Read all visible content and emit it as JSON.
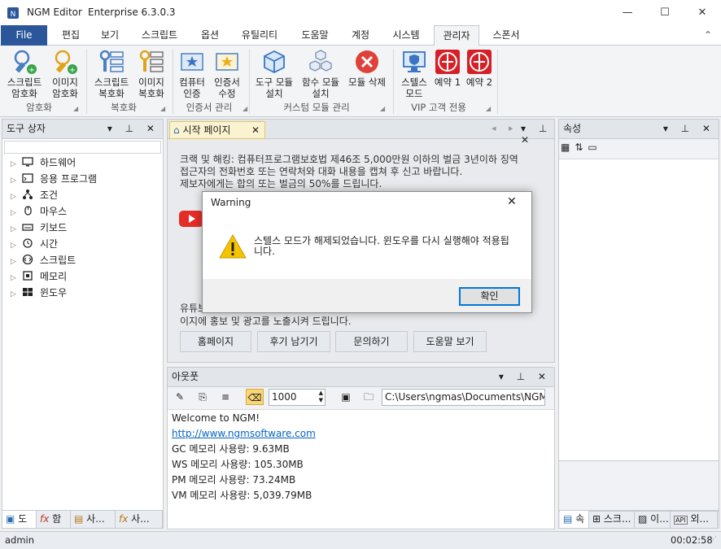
{
  "window": {
    "app_title": "NGM Editor",
    "edition": "Enterprise 6.3.0.3",
    "minimize": "—",
    "maximize": "☐",
    "close": "✕"
  },
  "menu": {
    "file": "File",
    "tabs": [
      "편집",
      "보기",
      "스크립트",
      "옵션",
      "유틸리티",
      "도움말",
      "계정",
      "시스템",
      "관리자",
      "스폰서"
    ],
    "active": "관리자",
    "collapse": "⌃"
  },
  "ribbon": {
    "groups": [
      {
        "label": "암호화",
        "buttons": [
          {
            "line1": "스크립트",
            "line2": "암호화"
          },
          {
            "line1": "이미지",
            "line2": "암호화"
          }
        ]
      },
      {
        "label": "복호화",
        "buttons": [
          {
            "line1": "스크립트",
            "line2": "복호화"
          },
          {
            "line1": "이미지",
            "line2": "복호화"
          }
        ]
      },
      {
        "label": "인증서 관리",
        "buttons": [
          {
            "line1": "컴퓨터",
            "line2": "인증"
          },
          {
            "line1": "인증서",
            "line2": "수정"
          }
        ]
      },
      {
        "label": "커스텀 모듈 관리",
        "buttons": [
          {
            "line1": "도구 모듈",
            "line2": "설치"
          },
          {
            "line1": "함수 모듈",
            "line2": "설치"
          },
          {
            "line1": "모듈 삭제",
            "line2": ""
          }
        ]
      },
      {
        "label": "VIP 고객 전용",
        "buttons": [
          {
            "line1": "스텔스",
            "line2": "모드"
          },
          {
            "line1": "예약 1",
            "line2": ""
          },
          {
            "line1": "예약 2",
            "line2": ""
          }
        ]
      }
    ]
  },
  "toolbox": {
    "title": "도구 상자",
    "items": [
      "하드웨어",
      "응용 프로그램",
      "조건",
      "마우스",
      "키보드",
      "시간",
      "스크립트",
      "메모리",
      "윈도우"
    ],
    "bottom_tabs": [
      "도",
      "함",
      "사...",
      "사..."
    ]
  },
  "document": {
    "tab": "시작 페이지",
    "notice_lines": [
      "크랙 및 해킹: 컴퓨터프로그램보호법 제46조 5,000만원 이하의 벌금 3년이하 징역",
      "접근자의 전화번호 또는 연락처와 대화 내용을 캡쳐 후 신고 바랍니다.",
      "제보자에게는 합의 또는 벌금의 50%를 드립니다."
    ],
    "promo_partial": "유튜브",
    "promo_line2": "이지에 홍보 및 광고를 노출시켜 드립니다.",
    "buttons": [
      "홈페이지",
      "후기 남기기",
      "문의하기",
      "도움말 보기"
    ]
  },
  "output": {
    "title": "아웃풋",
    "count": "1000",
    "path": "C:\\Users\\ngmas\\Documents\\NGM6\\",
    "lines": [
      "Welcome to NGM!",
      "http://www.ngmsoftware.com",
      "GC 메모리 사용량: 9.63MB",
      "WS 메모리 사용량: 105.30MB",
      "PM 메모리 사용량: 73.24MB",
      "VM 메모리 사용량: 5,039.79MB"
    ]
  },
  "properties": {
    "title": "속성",
    "bottom_tabs": [
      "속",
      "스크...",
      "이...",
      "외..."
    ]
  },
  "dialog": {
    "title": "Warning",
    "message_line1": "스텔스 모드가 해제되었습니다. 윈도우를 다시 실행해야 적용됩",
    "message_line2": "니다.",
    "ok": "확인"
  },
  "status": {
    "user": "admin",
    "time": "00:02:58"
  },
  "colors": {
    "accent": "#2b579a",
    "warning": "#f5c400",
    "danger": "#e0403a",
    "youtube": "#e52d27",
    "link": "#0563c1"
  }
}
